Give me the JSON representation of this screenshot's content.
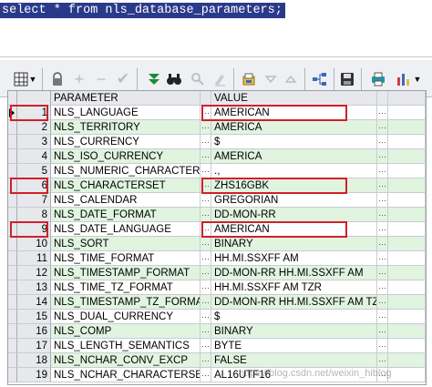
{
  "editor": {
    "sql": "select * from nls_database_parameters;"
  },
  "toolbar": {
    "icons": [
      "grid-view-icon",
      "lock-icon",
      "add-record-icon",
      "delete-record-icon",
      "post-edit-icon",
      "fetch-next-page-icon",
      "fetch-last-page-icon",
      "find-icon",
      "clear-icon",
      "export-icon",
      "sort-up-icon",
      "sort-down-icon",
      "query-tree-icon",
      "save-icon",
      "print-icon",
      "chart-icon"
    ]
  },
  "grid": {
    "columns": [
      "PARAMETER",
      "VALUE"
    ],
    "rows": [
      {
        "n": "1",
        "param": "NLS_LANGUAGE",
        "value": "AMERICAN"
      },
      {
        "n": "2",
        "param": "NLS_TERRITORY",
        "value": "AMERICA"
      },
      {
        "n": "3",
        "param": "NLS_CURRENCY",
        "value": "$"
      },
      {
        "n": "4",
        "param": "NLS_ISO_CURRENCY",
        "value": "AMERICA"
      },
      {
        "n": "5",
        "param": "NLS_NUMERIC_CHARACTERS",
        "value": ".,"
      },
      {
        "n": "6",
        "param": "NLS_CHARACTERSET",
        "value": "ZHS16GBK"
      },
      {
        "n": "7",
        "param": "NLS_CALENDAR",
        "value": "GREGORIAN"
      },
      {
        "n": "8",
        "param": "NLS_DATE_FORMAT",
        "value": "DD-MON-RR"
      },
      {
        "n": "9",
        "param": "NLS_DATE_LANGUAGE",
        "value": "AMERICAN"
      },
      {
        "n": "10",
        "param": "NLS_SORT",
        "value": "BINARY"
      },
      {
        "n": "11",
        "param": "NLS_TIME_FORMAT",
        "value": "HH.MI.SSXFF AM"
      },
      {
        "n": "12",
        "param": "NLS_TIMESTAMP_FORMAT",
        "value": "DD-MON-RR HH.MI.SSXFF AM"
      },
      {
        "n": "13",
        "param": "NLS_TIME_TZ_FORMAT",
        "value": "HH.MI.SSXFF AM TZR"
      },
      {
        "n": "14",
        "param": "NLS_TIMESTAMP_TZ_FORMAT",
        "value": "DD-MON-RR HH.MI.SSXFF AM TZR"
      },
      {
        "n": "15",
        "param": "NLS_DUAL_CURRENCY",
        "value": "$"
      },
      {
        "n": "16",
        "param": "NLS_COMP",
        "value": "BINARY"
      },
      {
        "n": "17",
        "param": "NLS_LENGTH_SEMANTICS",
        "value": "BYTE"
      },
      {
        "n": "18",
        "param": "NLS_NCHAR_CONV_EXCP",
        "value": "FALSE"
      },
      {
        "n": "19",
        "param": "NLS_NCHAR_CHARACTERSET",
        "value": "AL16UTF16"
      }
    ],
    "more_glyph": "···",
    "highlighted_rows": [
      1,
      6,
      9
    ],
    "highlight_color": "#d0202a",
    "alt_row_color": "#e0f4e0"
  },
  "watermark": "https://blog.csdn.net/weixin_hiblog"
}
